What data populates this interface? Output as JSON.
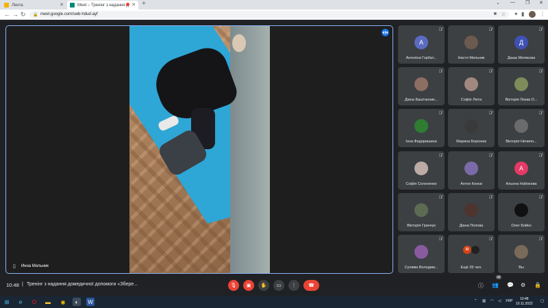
{
  "browser": {
    "tabs": [
      {
        "label": "Лента"
      },
      {
        "label": "Meet – Тренінг з надання д"
      }
    ],
    "url": "meet.google.com/swb-hdud-ayf"
  },
  "meeting": {
    "time": "10:48",
    "title": "Тренінг з надання домедичної допомоги «Збере...",
    "main_speaker": "Инна Мельник"
  },
  "participants": [
    {
      "name": "Ангеліна Горбат...",
      "initial": "А",
      "color": "#5c6bc0"
    },
    {
      "name": "Настя Мельник",
      "initial": "",
      "color": "#6d5a4f"
    },
    {
      "name": "Даша Матвєєва",
      "initial": "Д",
      "color": "#3f51b5"
    },
    {
      "name": "Діана Баштанник...",
      "initial": "",
      "color": "#8d6e63"
    },
    {
      "name": "Софія Люта",
      "initial": "",
      "color": "#a1887f"
    },
    {
      "name": "Вікторія Лизак О...",
      "initial": "",
      "color": "#7e8c5a"
    },
    {
      "name": "Інна Федоришина",
      "initial": "",
      "color": "#2e7d32"
    },
    {
      "name": "Марина Боронюк",
      "initial": "",
      "color": "#3a3a3a"
    },
    {
      "name": "Вікторія Ничипо...",
      "initial": "",
      "color": "#6b6b6b"
    },
    {
      "name": "Софія Солоненко",
      "initial": "",
      "color": "#bcaaa4"
    },
    {
      "name": "Антон Конєв",
      "initial": "",
      "color": "#7b6aa8"
    },
    {
      "name": "Альона Набокова",
      "initial": "А",
      "color": "#e53966"
    },
    {
      "name": "Вікторія Гринчук",
      "initial": "",
      "color": "#5d6b52"
    },
    {
      "name": "Діана Попова",
      "initial": "",
      "color": "#4e342e"
    },
    {
      "name": "Олег Бойко",
      "initial": "",
      "color": "#111111"
    },
    {
      "name": "Сулима Володим...",
      "initial": "",
      "color": "#8a5aa0"
    },
    {
      "name": "Ещё 26 чел.",
      "initial": "",
      "color": "#3c4043",
      "more": [
        "М",
        ""
      ]
    },
    {
      "name": "Вы",
      "initial": "",
      "color": "#7a6a5a"
    }
  ],
  "people_count": "44",
  "taskbar": {
    "lang": "УКР",
    "time": "10:48",
    "date": "10.11.2022"
  },
  "icons": {
    "mic_off": "mic-off-icon",
    "cam_off": "camera-off-icon",
    "hand": "raise-hand-icon",
    "present": "present-icon",
    "more": "more-options-icon",
    "hangup": "hang-up-icon",
    "info": "info-icon",
    "people": "people-icon",
    "chat": "chat-icon",
    "activities": "activities-icon",
    "lock": "lock-icon"
  },
  "colors": {
    "accent": "#8ab4f8",
    "danger": "#ea4335",
    "tile": "#3c4043",
    "background": "#202124"
  }
}
